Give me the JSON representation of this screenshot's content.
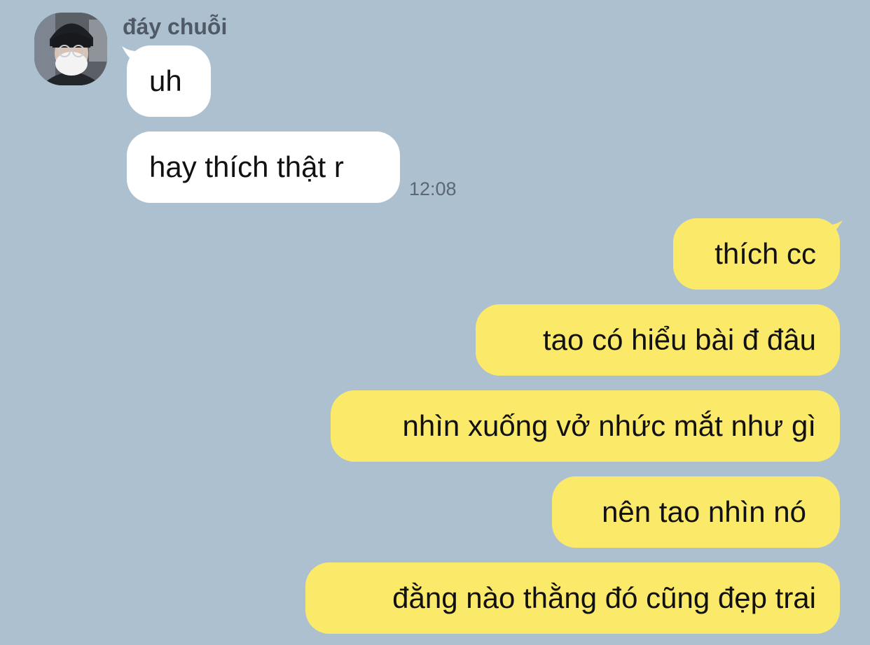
{
  "chat": {
    "sender_name": "đáy chuỗi",
    "incoming": [
      {
        "text": "uh"
      },
      {
        "text": "hay thích thật r",
        "time": "12:08"
      }
    ],
    "outgoing": [
      {
        "text": "thích cc"
      },
      {
        "text": "tao có hiểu bài đ đâu"
      },
      {
        "text": "nhìn xuống vở nhức mắt như gì"
      },
      {
        "text": "nên tao nhìn nó"
      },
      {
        "text": "đằng nào thằng đó cũng đẹp trai"
      }
    ]
  },
  "colors": {
    "background": "#adc0d0",
    "incoming_bubble": "#ffffff",
    "outgoing_bubble": "#fbe96a",
    "sender_name": "#4f5a66",
    "timestamp": "#5b6873"
  }
}
